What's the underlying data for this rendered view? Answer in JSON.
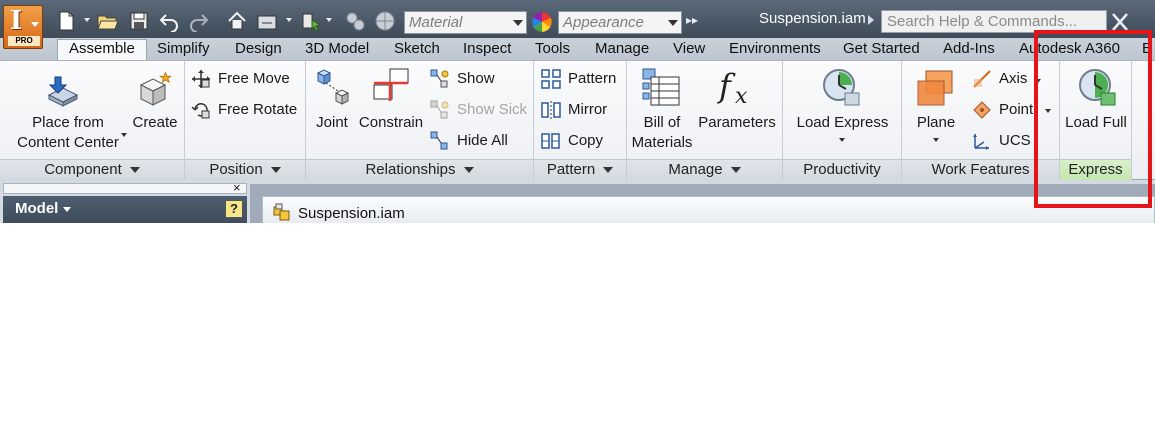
{
  "app": {
    "button_letter": "I",
    "edition_badge": "PRO",
    "document_title": "Suspension.iam",
    "search_placeholder": "Search Help & Commands..."
  },
  "quick_access": {
    "material_combo": "Material",
    "appearance_combo": "Appearance",
    "overflow_glyph": "▸▸"
  },
  "tabs": [
    {
      "label": "Assemble",
      "active": true
    },
    {
      "label": "Simplify"
    },
    {
      "label": "Design"
    },
    {
      "label": "3D Model"
    },
    {
      "label": "Sketch"
    },
    {
      "label": "Inspect"
    },
    {
      "label": "Tools"
    },
    {
      "label": "Manage"
    },
    {
      "label": "View"
    },
    {
      "label": "Environments"
    },
    {
      "label": "Get Started"
    },
    {
      "label": "Add-Ins"
    },
    {
      "label": "Autodesk A360"
    },
    {
      "label": "E"
    }
  ],
  "panels": {
    "component": {
      "title": "Component",
      "place_line1": "Place from",
      "place_line2": "Content Center",
      "create": "Create"
    },
    "position": {
      "title": "Position",
      "free_move": "Free Move",
      "free_rotate": "Free Rotate"
    },
    "relationships": {
      "title": "Relationships",
      "joint": "Joint",
      "constrain": "Constrain",
      "show": "Show",
      "show_sick": "Show Sick",
      "hide_all": "Hide All"
    },
    "pattern": {
      "title": "Pattern",
      "pattern": "Pattern",
      "mirror": "Mirror",
      "copy": "Copy"
    },
    "manage": {
      "title": "Manage",
      "bom_line1": "Bill of",
      "bom_line2": "Materials",
      "parameters": "Parameters"
    },
    "productivity": {
      "title": "Productivity",
      "load_express": "Load Express"
    },
    "work_features": {
      "title": "Work Features",
      "plane": "Plane",
      "axis": "Axis",
      "point": "Point",
      "ucs": "UCS"
    },
    "express": {
      "title": "Express",
      "load_full": "Load Full"
    }
  },
  "browser": {
    "close_glyph": "×",
    "model_label": "Model",
    "help_glyph": "?"
  },
  "document_tab": {
    "name": "Suspension.iam"
  },
  "colors": {
    "annotation": "#e3151a",
    "express_highlight": "#c5e6b0",
    "app_orange": "#d56615"
  }
}
